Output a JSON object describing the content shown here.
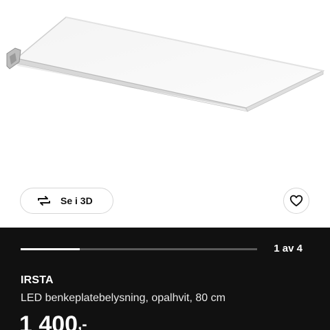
{
  "product_image": {
    "alt": "LED benkeplatebelysning panel"
  },
  "view_3d": {
    "label": "Se i 3D",
    "icon": "rotate-3d-icon"
  },
  "favourite": {
    "icon": "heart-icon"
  },
  "carousel": {
    "counter": "1 av 4",
    "progress": 0.25
  },
  "product": {
    "name": "IRSTA",
    "description": "LED benkeplatebelysning, opalhvit, 80 cm",
    "price": "1 400",
    "price_suffix": ",-"
  }
}
